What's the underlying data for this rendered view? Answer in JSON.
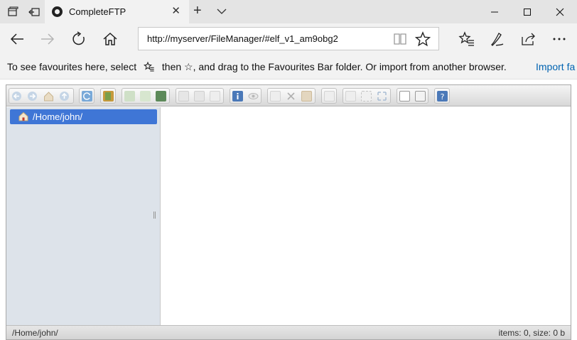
{
  "browser": {
    "tab": {
      "title": "CompleteFTP"
    },
    "address": "http://myserver/FileManager/#elf_v1_am9obg2",
    "icons": [
      "tab-preview-icon",
      "set-tabs-aside-icon",
      "site-favicon",
      "close-tab-icon",
      "new-tab-icon",
      "tab-list-chevron-icon",
      "minimize-icon",
      "maximize-icon",
      "close-window-icon",
      "back-icon",
      "forward-icon",
      "refresh-icon",
      "home-icon",
      "reading-view-icon",
      "favorite-star-icon",
      "favorites-hub-icon",
      "web-note-icon",
      "share-icon",
      "more-icon"
    ]
  },
  "favourites_bar": {
    "hint_before": "To see favourites here, select",
    "hint_after": "then ☆, and drag to the Favourites Bar folder. Or import from another browser.",
    "import_link": "Import fa"
  },
  "file_manager": {
    "tree": {
      "selected": "/Home/john/"
    },
    "status": {
      "path": "/Home/john/",
      "info": "items: 0, size: 0 b"
    },
    "colors": {
      "selection": "#3f76d6",
      "sidebar": "#dde3ea"
    }
  }
}
